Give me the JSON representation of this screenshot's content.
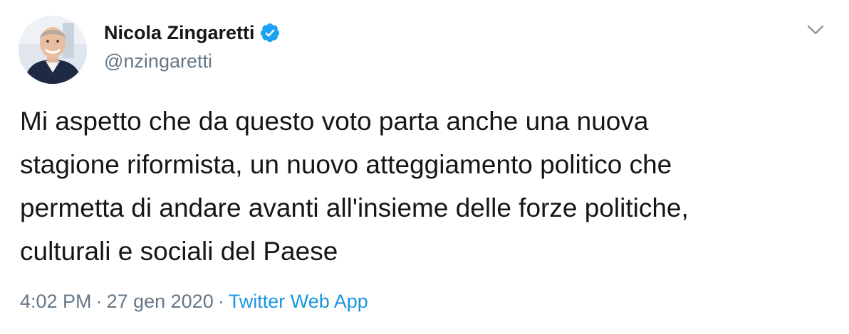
{
  "author": {
    "name": "Nicola Zingaretti",
    "handle": "@nzingaretti",
    "verified": true
  },
  "tweet": {
    "lines": [
      "Mi aspetto che da questo voto parta anche una nuova",
      "stagione riformista, un nuovo atteggiamento politico che",
      "permetta di andare avanti all'insieme delle forze politiche,",
      "culturali e sociali del Paese"
    ]
  },
  "meta": {
    "time": "4:02 PM",
    "separator": "·",
    "date": "27 gen 2020",
    "source": "Twitter Web App"
  },
  "icons": {
    "verified": "verified-badge-icon",
    "menu": "chevron-down-icon"
  },
  "colors": {
    "text": "#14171a",
    "secondary": "#657786",
    "link": "#1b95e0",
    "verified": "#1da1f2"
  }
}
